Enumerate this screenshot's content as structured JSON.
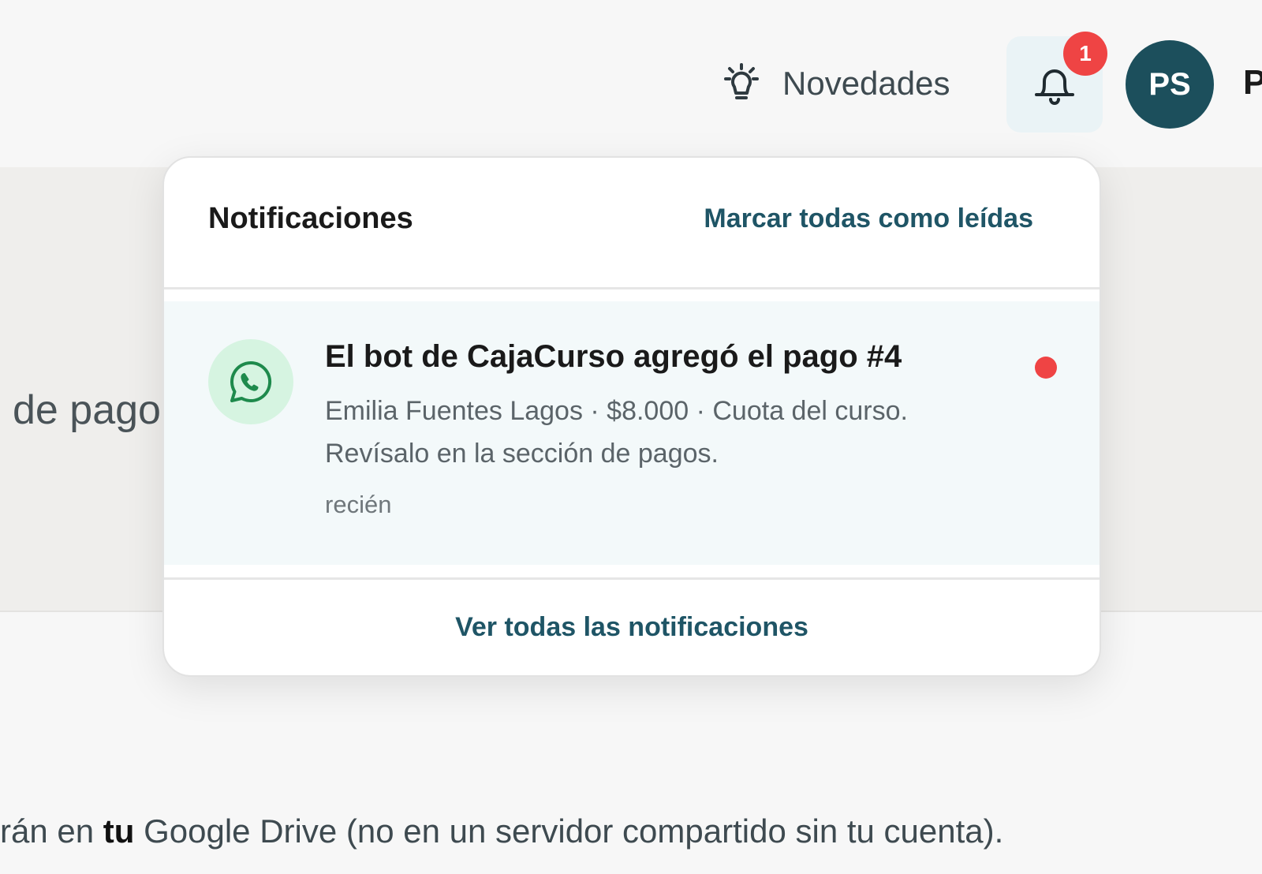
{
  "header": {
    "novedades_label": "Novedades",
    "notification_count": "1",
    "avatar_initials": "PS",
    "user_name_partial": "P"
  },
  "background": {
    "band_text_partial": "de pago",
    "bottom_text_before": "rán en ",
    "bottom_text_bold": "tu",
    "bottom_text_after": " Google Drive (no en un servidor compartido sin tu cuenta)."
  },
  "notifications_panel": {
    "title": "Notificaciones",
    "mark_all_read_label": "Marcar todas como leídas",
    "items": [
      {
        "icon": "whatsapp-icon",
        "title": "El bot de CajaCurso agregó el pago #4",
        "body": "Emilia Fuentes Lagos · $8.000 · Cuota del curso. Revísalo en la sección de pagos.",
        "time": "recién",
        "unread": true
      }
    ],
    "view_all_label": "Ver todas las notificaciones"
  },
  "colors": {
    "accent": "#1f5566",
    "avatar_bg": "#1c4f5c",
    "badge_red": "#ef4444",
    "notification_bg": "#f3f9fa",
    "whatsapp_green": "#1e8a4c",
    "whatsapp_circle_bg": "#d6f4e1"
  }
}
